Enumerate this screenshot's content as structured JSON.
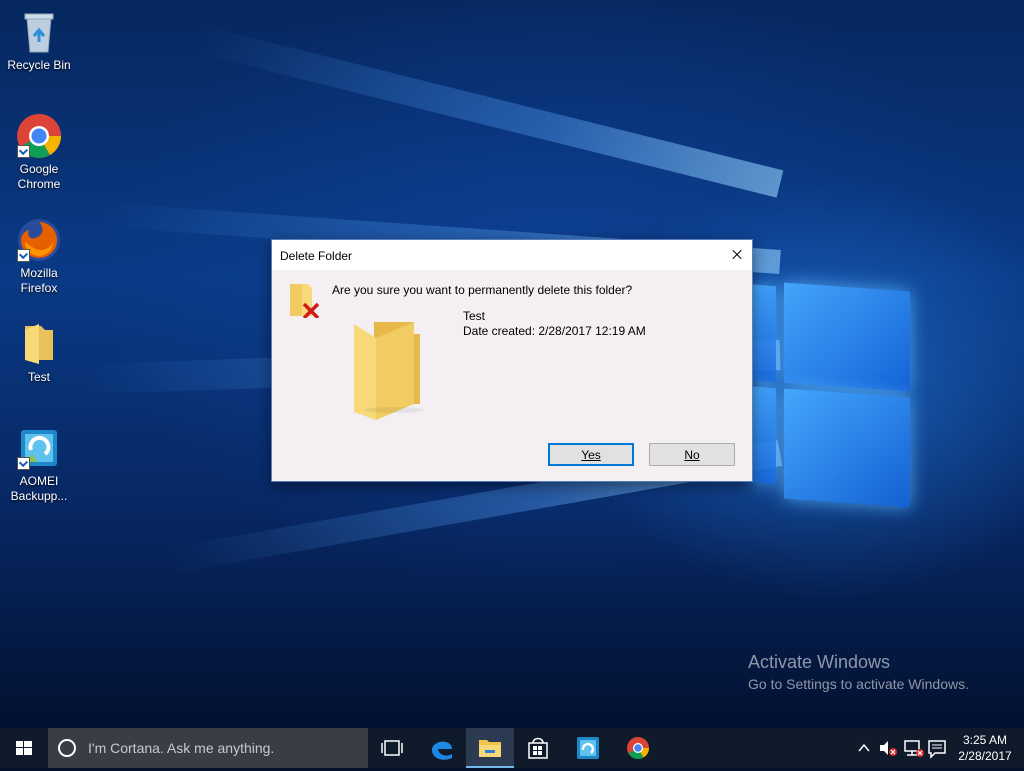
{
  "desktop": {
    "icons": [
      {
        "label": "Recycle Bin"
      },
      {
        "label": "Google Chrome"
      },
      {
        "label": "Mozilla Firefox"
      },
      {
        "label": "Test"
      },
      {
        "label": "AOMEI Backupp..."
      }
    ]
  },
  "dialog": {
    "title": "Delete Folder",
    "question": "Are you sure you want to permanently delete this folder?",
    "item_name": "Test",
    "item_date": "Date created: 2/28/2017 12:19 AM",
    "yes_label": "Yes",
    "no_label": "No"
  },
  "watermark": {
    "line1": "Activate Windows",
    "line2": "Go to Settings to activate Windows."
  },
  "taskbar": {
    "search_placeholder": "I'm Cortana. Ask me anything.",
    "pinned": [
      "task-view-icon",
      "edge-icon",
      "file-explorer-icon",
      "store-icon",
      "aomei-icon",
      "chrome-icon"
    ],
    "clock_time": "3:25 AM",
    "clock_date": "2/28/2017"
  }
}
